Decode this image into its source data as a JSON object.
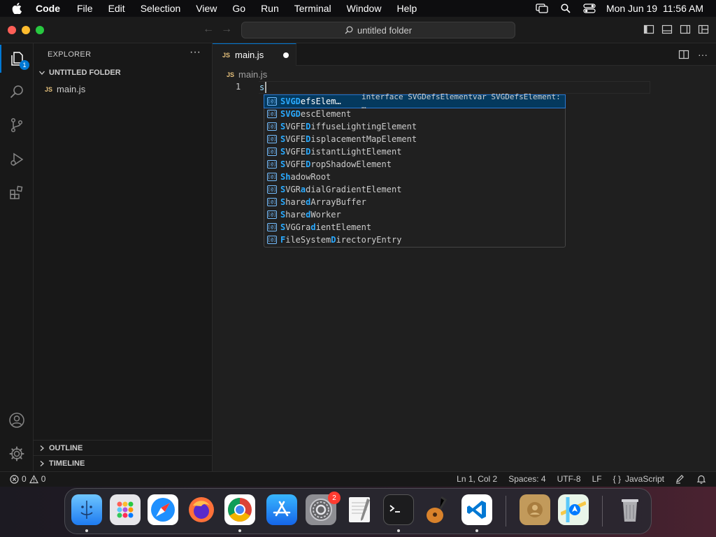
{
  "menubar": {
    "app_name": "Code",
    "items": [
      "File",
      "Edit",
      "Selection",
      "View",
      "Go",
      "Run",
      "Terminal",
      "Window",
      "Help"
    ],
    "datetime": "Mon Jun 19  11:56 AM"
  },
  "titlebar": {
    "search_text": "untitled folder"
  },
  "activity": {
    "explorer_badge": "1"
  },
  "sidebar": {
    "title": "EXPLORER",
    "more": "···",
    "folder_name": "UNTITLED FOLDER",
    "file": {
      "badge": "JS",
      "name": "main.js"
    },
    "outline": "OUTLINE",
    "timeline": "TIMELINE"
  },
  "editor": {
    "tab": {
      "badge": "JS",
      "name": "main.js"
    },
    "breadcrumb": {
      "badge": "JS",
      "name": "main.js"
    },
    "line_number": "1",
    "code": "s"
  },
  "suggestions": {
    "items": [
      {
        "pre": "S",
        "m1": "VGD",
        "mid": "efsElem…",
        "detail": "interface SVGDefsElementvar SVGDefsElement: …"
      },
      {
        "pre": "S",
        "m1": "VGD",
        "mid": "escElement"
      },
      {
        "pre": "SVGFE",
        "m1": "D",
        "mid": "iffuseLightingElement"
      },
      {
        "pre": "SVGFE",
        "m1": "D",
        "mid": "isplacementMapElement"
      },
      {
        "pre": "SVGFE",
        "m1": "D",
        "mid": "istantLightElement"
      },
      {
        "pre": "SVGFE",
        "m1": "D",
        "mid": "ropShadowElement"
      },
      {
        "pre": "S",
        "m1": "h",
        "mid": "adowRoot"
      },
      {
        "pre": "SVGR",
        "m1": "a",
        "mid": "dialGradientElement"
      },
      {
        "pre": "Share",
        "m1": "d",
        "mid": "ArrayBuffer"
      },
      {
        "pre": "Share",
        "m1": "d",
        "mid": "Worker"
      },
      {
        "pre": "SVGGra",
        "m1": "d",
        "mid": "ientElement"
      },
      {
        "pre": "FileSystem",
        "m1": "D",
        "mid": "irectoryEntry"
      }
    ]
  },
  "statusbar": {
    "errors": "0",
    "warnings": "0",
    "position": "Ln 1, Col 2",
    "spaces": "Spaces: 4",
    "encoding": "UTF-8",
    "eol": "LF",
    "language": "JavaScript"
  },
  "dock": {
    "settings_badge": "2"
  }
}
